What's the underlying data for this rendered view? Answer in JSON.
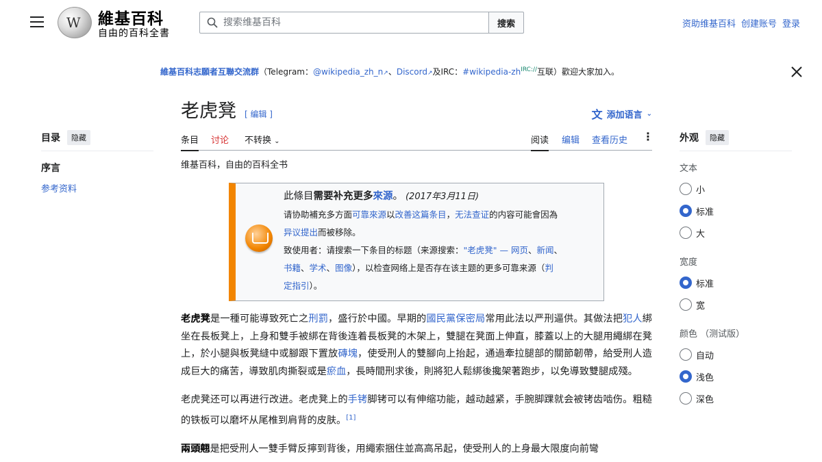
{
  "header": {
    "logo_title": "維基百科",
    "logo_subtitle": "自由的百科全書",
    "search_placeholder": "搜索维基百科",
    "search_button": "搜索",
    "user_links": [
      "资助维基百科",
      "创建账号",
      "登录"
    ]
  },
  "sitenotice": {
    "group_link": "維基百科志願者互聯交流群",
    "open_paren": "（Telegram：",
    "telegram": "@wikipedia_zh_n",
    "sep1": "、",
    "discord": "Discord",
    "and_irc": "及IRC：",
    "irc": "#wikipedia-zh",
    "irc_sup": "IRC://",
    "tail": "互联）歡迎大家加入。"
  },
  "toc": {
    "title": "目录",
    "hide": "隐藏",
    "items": [
      "序言",
      "参考资料"
    ]
  },
  "article": {
    "title": "老虎凳",
    "edit_link": "[ 编辑 ]",
    "add_languages": "添加语言",
    "tabs_left": [
      "条目",
      "讨论",
      "不转换"
    ],
    "tabs_right": [
      "阅读",
      "编辑",
      "查看历史"
    ],
    "tagline": "维基百科，自由的百科全书"
  },
  "ambox": {
    "title_prefix": "此條目",
    "title_bold": "需要补充更多",
    "title_link": "來源",
    "title_suffix": "。",
    "date": "(2017年3月11日)",
    "l2_a": "请协助補充多方面",
    "l2_link1": "可靠來源",
    "l2_b": "以",
    "l2_link2": "改善这篇条目",
    "l2_c": "，",
    "l2_link3": "无法查证",
    "l2_d": "的内容可能會因為",
    "l3_link": "异议提出",
    "l3_tail": "而被移除。",
    "l4_a": "致使用者：请搜索一下条目的标题（来源搜索：",
    "l4_link1": "\"老虎凳\"",
    "l4_b": " — ",
    "l4_link2": "网页",
    "l4_link3": "新闻",
    "l5_link1": "书籍",
    "l5_link2": "学术",
    "l5_link3": "图像",
    "l5_tail": "），以检查网络上是否存在该主题的更多可靠来源（",
    "l5_link4": "判",
    "l6_link": "定指引",
    "l6_tail": "）。"
  },
  "paragraphs": {
    "p1_bold": "老虎凳",
    "p1_a": "是一種可能導致死亡之",
    "p1_link1": "刑罰",
    "p1_b": "，盛行於中國。早期的",
    "p1_link2": "國民黨保密局",
    "p1_c": "常用此法以严刑逼供。其做法把",
    "p1_link3": "犯人",
    "p1_d": "綁坐在長板凳上，上身和雙手被綁在背後连着長板凳的木架上，雙腿在凳面上伸直，膝蓋以上的大腿用繩綁在凳上，於小腿與板凳縫中或腳跟下置放",
    "p1_link4": "磚塊",
    "p1_e": "，使受刑人的雙腳向上抬起，通過牽拉腿部的關節韌帶，給受刑人造成巨大的痛苦，導致肌肉撕裂或是",
    "p1_link5": "瘀血",
    "p1_f": "，長時間刑求後，則將犯人鬆綁後攙架著跑步，以免導致雙腿成殘。",
    "p2_a": "老虎凳还可以再进行改进。老虎凳上的",
    "p2_link": "手铐",
    "p2_b": "脚铐可以有伸缩功能，越动越紧，手腕脚踝就会被铐齿啮伤。粗糙的铁板可以磨坏从尾椎到肩背的皮肤。",
    "p2_ref": "[1]",
    "p3_bold": "兩頭翹",
    "p3_a": "是把受刑人一雙手臂反擰到背後，用繩索捆住並高高吊起，使受刑人的上身最大限度向前彎"
  },
  "appearance": {
    "title": "外观",
    "hide": "隐藏",
    "text_label": "文本",
    "text_options": [
      "小",
      "标准",
      "大"
    ],
    "width_label": "宽度",
    "width_options": [
      "标准",
      "宽"
    ],
    "color_label": "颜色 （测试版）",
    "color_options": [
      "自动",
      "浅色",
      "深色"
    ]
  }
}
